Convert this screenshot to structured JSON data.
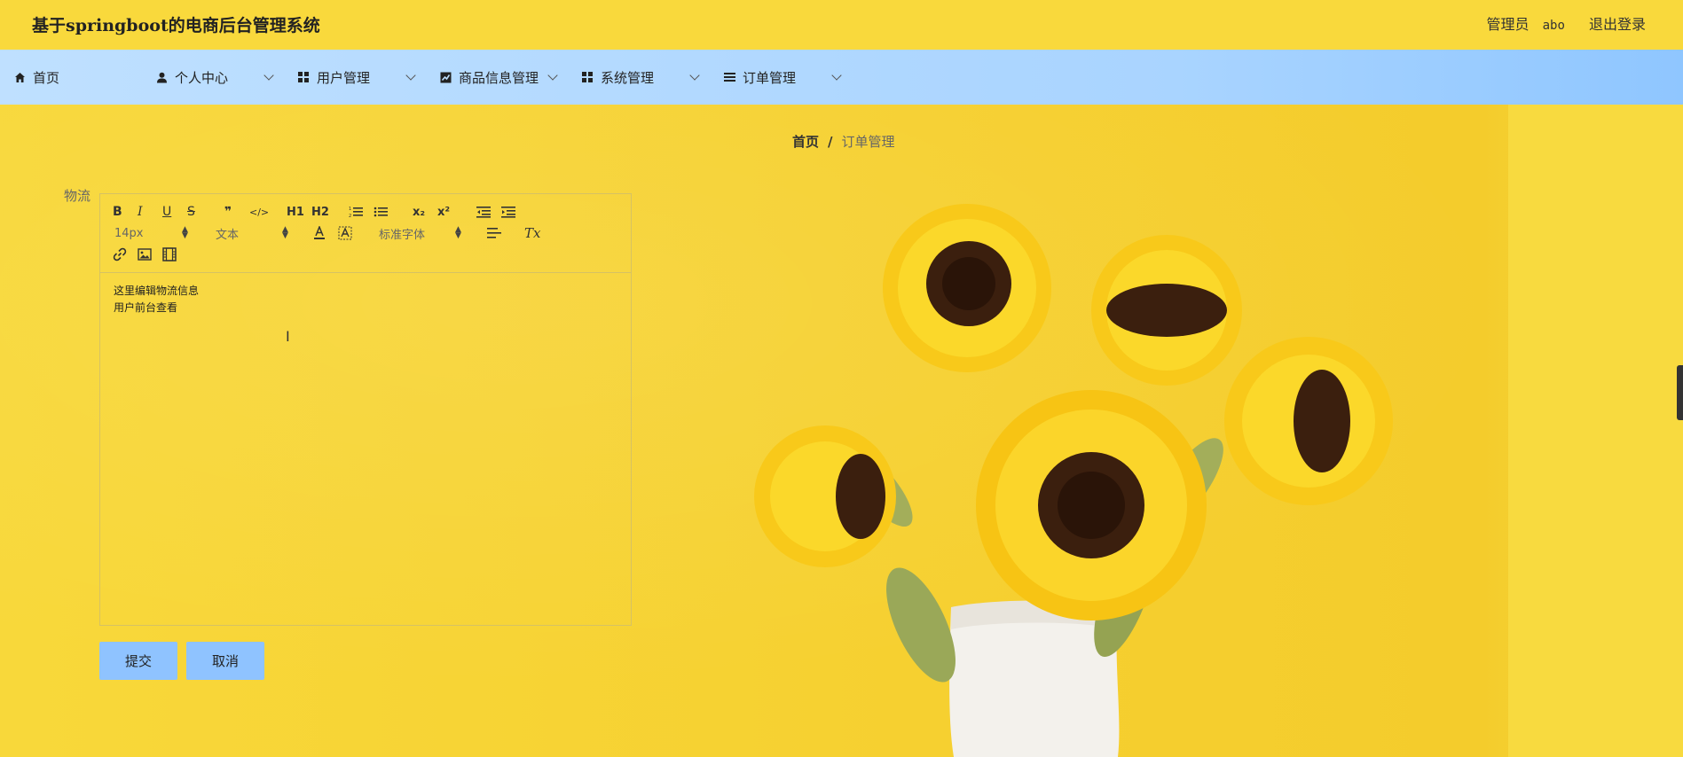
{
  "header": {
    "title": "基于springboot的电商后台管理系统",
    "user_role": "管理员",
    "username": "abo",
    "logout_label": "退出登录"
  },
  "nav": {
    "items": [
      {
        "label": "首页",
        "icon": "home-icon"
      },
      {
        "label": "个人中心",
        "icon": "user-icon"
      },
      {
        "label": "用户管理",
        "icon": "grid-icon"
      },
      {
        "label": "商品信息管理",
        "icon": "chart-icon"
      },
      {
        "label": "系统管理",
        "icon": "grid-icon"
      },
      {
        "label": "订单管理",
        "icon": "list-icon"
      }
    ]
  },
  "breadcrumb": {
    "home": "首页",
    "separator": "/",
    "current": "订单管理"
  },
  "form": {
    "field_label": "物流",
    "editor": {
      "font_size": "14px",
      "block_format": "文本",
      "font_family": "标准字体",
      "content_lines": [
        "这里编辑物流信息",
        "用户前台查看"
      ],
      "toolbar_glyphs": {
        "bold": "B",
        "italic": "I",
        "underline": "U",
        "strike": "S",
        "quote": "❞",
        "code": "</>",
        "h1": "H1",
        "h2": "H2",
        "sub": "x₂",
        "sup": "x²",
        "clean": "Tx"
      }
    },
    "submit_label": "提交",
    "cancel_label": "取消"
  },
  "colors": {
    "background": "#f7d736",
    "nav_gradient_start": "#bfe0ff",
    "button": "#8fc3ff"
  }
}
